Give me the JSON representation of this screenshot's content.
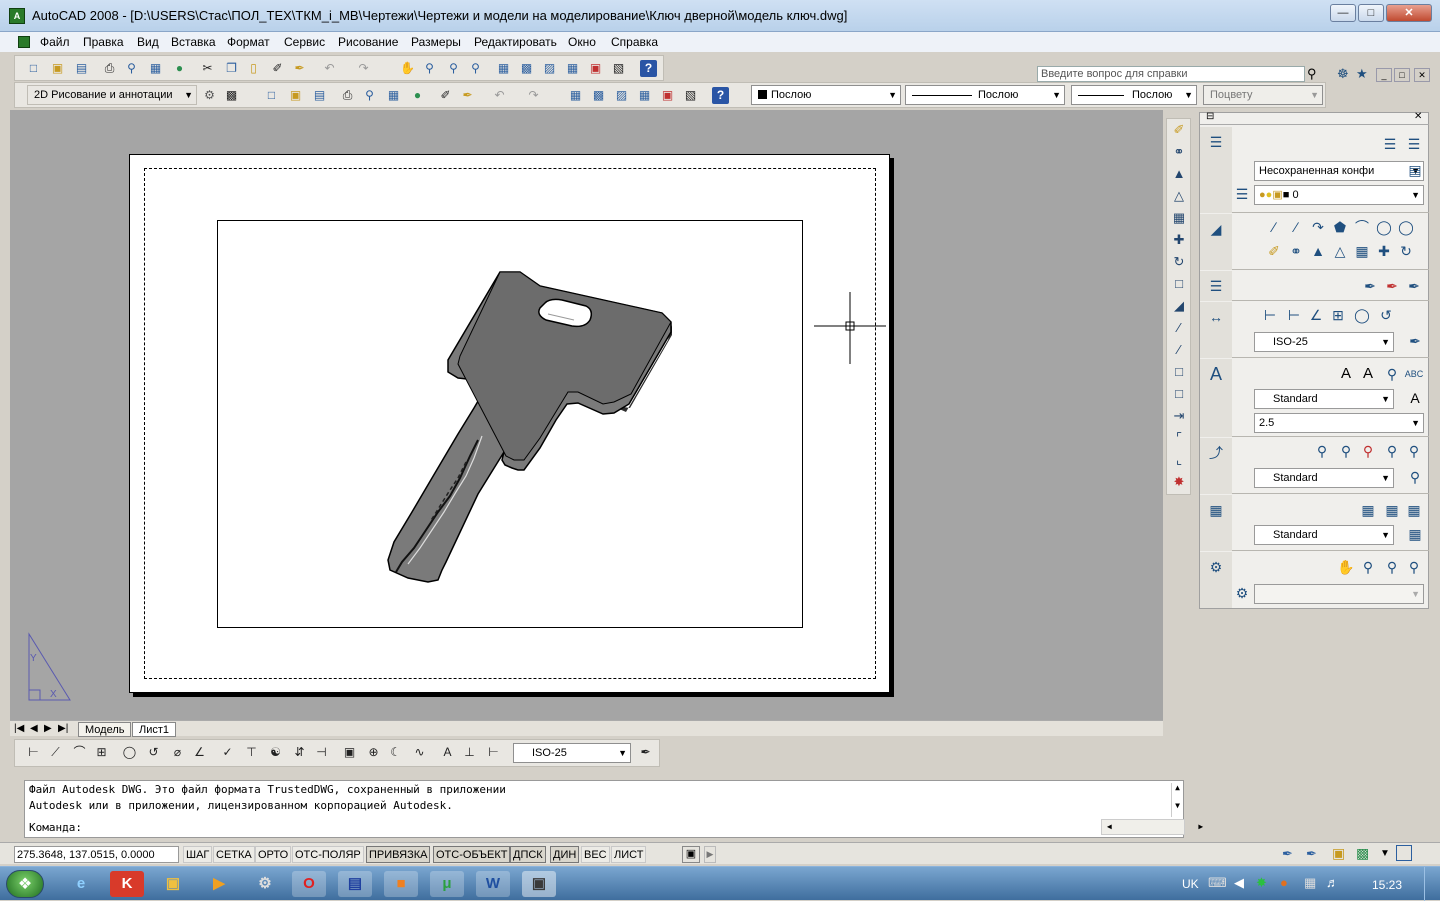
{
  "window": {
    "title": "AutoCAD 2008 - [D:\\USERS\\Стас\\ПОЛ_ТЕХ\\ТКМ_i_МВ\\Чертежи\\Чертежи и модели на моделирование\\Ключ дверной\\модель ключ.dwg]",
    "app_icon_label": "A"
  },
  "menu": {
    "items": [
      "Файл",
      "Правка",
      "Вид",
      "Вставка",
      "Формат",
      "Сервис",
      "Рисование",
      "Размеры",
      "Редактировать",
      "Окно",
      "Справка"
    ],
    "help_placeholder": "Введите вопрос для справки"
  },
  "toolbars": {
    "workspace": "2D Рисование и аннотации",
    "color": "Послою",
    "linetype": "Послою",
    "lineweight": "Послою",
    "plotstyle": "Поцвету"
  },
  "layout_tabs": [
    "Модель",
    "Лист1"
  ],
  "dim_style": "ISO-25",
  "command": {
    "lines": [
      "Файл Autodesk DWG. Это файл формата TrustedDWG, сохраненный в приложении",
      "Autodesk или в приложении, лицензированном корпорацией Autodesk."
    ],
    "prompt": "Команда:"
  },
  "status": {
    "coords": "275.3648, 137.0515, 0.0000",
    "toggles": [
      {
        "label": "ШАГ",
        "on": false
      },
      {
        "label": "СЕТКА",
        "on": false
      },
      {
        "label": "ОРТО",
        "on": false
      },
      {
        "label": "ОТС-ПОЛЯР",
        "on": false
      },
      {
        "label": "ПРИВЯЗКА",
        "on": true
      },
      {
        "label": "ОТС-ОБЪЕКТ",
        "on": true
      },
      {
        "label": "ДПСК",
        "on": true
      },
      {
        "label": "ДИН",
        "on": true
      },
      {
        "label": "ВЕС",
        "on": false
      },
      {
        "label": "ЛИСТ",
        "on": false
      }
    ]
  },
  "dashboard": {
    "layer_state": "Несохраненная конфи",
    "layer": "0",
    "dim_style": "ISO-25",
    "text_style": "Standard",
    "text_height": "2.5",
    "mleader_style": "Standard",
    "table_style": "Standard"
  },
  "ucs": {
    "x": "X",
    "y": "Y"
  },
  "tray": {
    "lang": "UK",
    "time": "15:23"
  }
}
